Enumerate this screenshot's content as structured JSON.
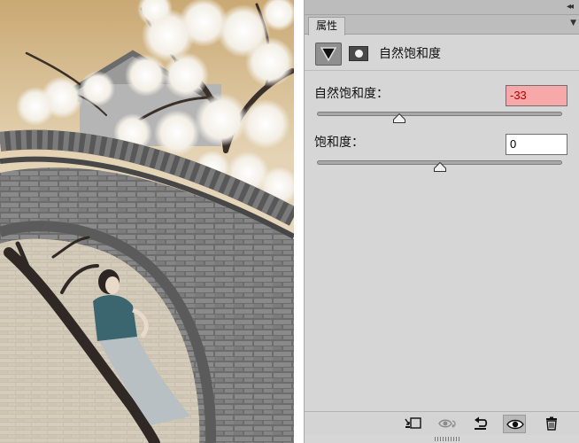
{
  "panel": {
    "collapse_glyph": "◂◂",
    "menu_glyph": "▼",
    "tab_label": "属性",
    "title": "自然饱和度",
    "adjustment_icon": "vibrance-triangle-icon",
    "mask_icon": "layer-mask-icon"
  },
  "controls": {
    "vibrance": {
      "label": "自然饱和度：",
      "value": "-33",
      "range": [
        -100,
        100
      ]
    },
    "saturation": {
      "label": "饱和度：",
      "value": "0",
      "range": [
        -100,
        100
      ]
    }
  },
  "toolbar": {
    "tools": [
      "clip-to-layer-icon",
      "view-previous-state-icon",
      "reset-icon",
      "toggle-visibility-icon",
      "trash-icon"
    ]
  },
  "colors": {
    "panel_bg": "#d6d6d6",
    "warning_field_bg": "#f7a9a9",
    "warning_text": "#b00000"
  }
}
